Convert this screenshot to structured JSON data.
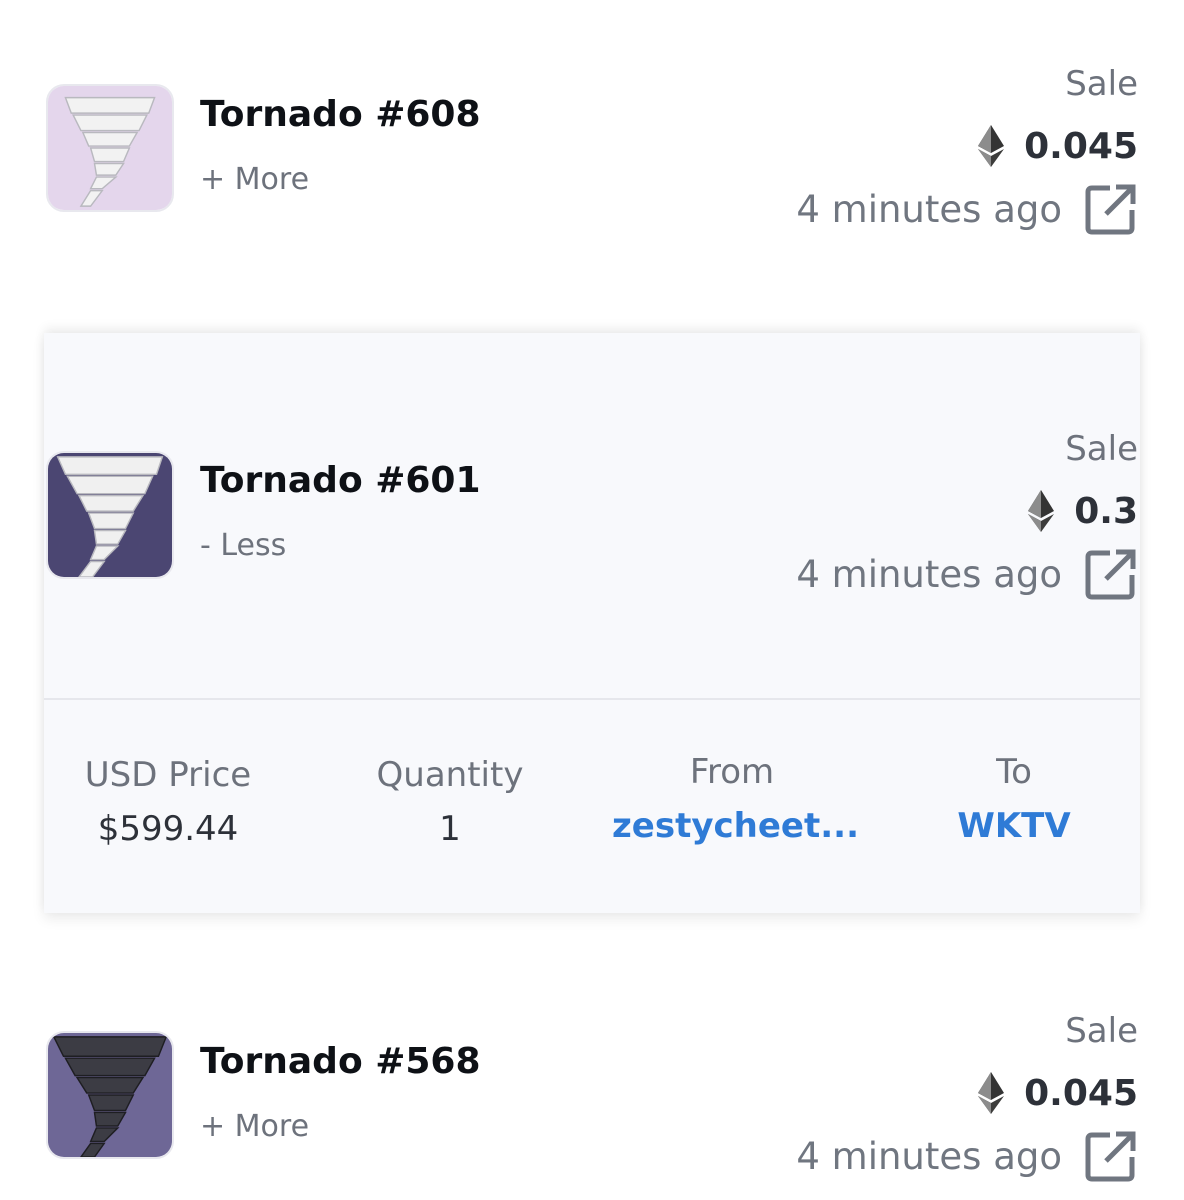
{
  "items": [
    {
      "name": "Tornado #608",
      "toggle": "+ More",
      "type": "Sale",
      "price": "0.045",
      "time": "4 minutes ago",
      "thumb_bg": "#e4d6ec",
      "tornado_color": "#f2f2f2"
    },
    {
      "name": "Tornado #601",
      "toggle": "- Less",
      "type": "Sale",
      "price": "0.3",
      "time": "4 minutes ago",
      "thumb_bg": "#4b4672",
      "tornado_color": "#f0f0f0",
      "details": {
        "usd_price_label": "USD Price",
        "usd_price": "$599.44",
        "quantity_label": "Quantity",
        "quantity": "1",
        "from_label": "From",
        "from": "zestycheet...",
        "to_label": "To",
        "to": "WKTV"
      }
    },
    {
      "name": "Tornado #568",
      "toggle": "+ More",
      "type": "Sale",
      "price": "0.045",
      "time": "4 minutes ago",
      "thumb_bg": "#6e6796",
      "tornado_color": "#3c3c44"
    }
  ],
  "colors": {
    "link": "#2f7bd6",
    "muted": "#6d727c",
    "title": "#0e1116",
    "expanded_bg": "#f8f9fc"
  },
  "icons": {
    "currency": "ethereum-icon",
    "link": "external-link-icon"
  }
}
